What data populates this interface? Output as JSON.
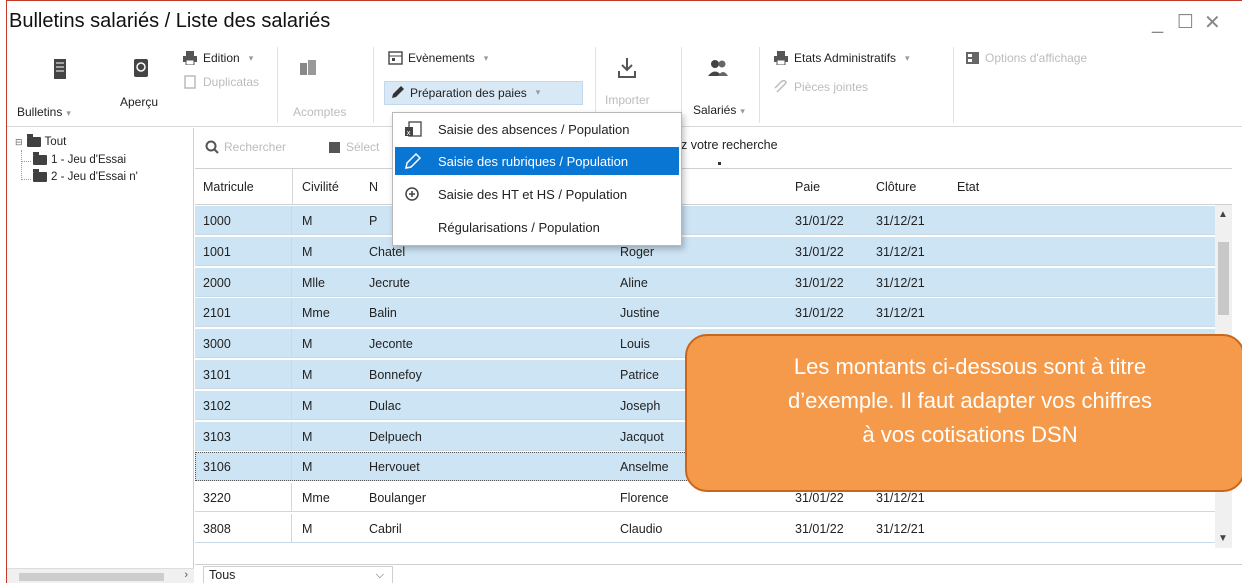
{
  "window": {
    "title": "Bulletins salariés / Liste des salariés",
    "controls": {
      "minimize": "_",
      "maximize": "☐",
      "close": "✕"
    }
  },
  "ribbon": {
    "bulletins": "Bulletins",
    "apercu": "Aperçu",
    "edition": "Edition",
    "duplicatas": "Duplicatas",
    "acomptes": "Acomptes",
    "evenements": "Evènements",
    "preparation": "Préparation des paies",
    "importer": "Importer",
    "salaries": "Salariés",
    "etats": "Etats Administratifs",
    "pieces": "Pièces jointes",
    "options": "Options d'affichage"
  },
  "dropdown": {
    "items": [
      {
        "label": "Saisie des absences / Population",
        "icon": "spreadsheet-icon"
      },
      {
        "label": "Saisie des rubriques / Population",
        "icon": "pencil-icon",
        "active": true
      },
      {
        "label": "Saisie des HT et HS / Population",
        "icon": "plus-circle-icon"
      },
      {
        "label": "Régularisations / Population",
        "icon": ""
      }
    ]
  },
  "tree": {
    "root": "Tout",
    "children": [
      "1 - Jeu d'Essai",
      "2 - Jeu d'Essai n'"
    ]
  },
  "search": {
    "rechercher": "Rechercher",
    "selection": "Sélect",
    "hint": "z votre recherche"
  },
  "grid": {
    "columns": {
      "matricule": "Matricule",
      "civilite": "Civilité",
      "nom": "N",
      "paie": "Paie",
      "cloture": "Clôture",
      "etat": "Etat"
    },
    "rows": [
      {
        "matricule": "1000",
        "civilite": "M",
        "nom": "P",
        "prenom": "",
        "paie": "31/01/22",
        "cloture": "31/12/21"
      },
      {
        "matricule": "1001",
        "civilite": "M",
        "nom": "Chatel",
        "prenom": "Roger",
        "paie": "31/01/22",
        "cloture": "31/12/21"
      },
      {
        "matricule": "2000",
        "civilite": "Mlle",
        "nom": "Jecrute",
        "prenom": "Aline",
        "paie": "31/01/22",
        "cloture": "31/12/21"
      },
      {
        "matricule": "2101",
        "civilite": "Mme",
        "nom": "Balin",
        "prenom": "Justine",
        "paie": "31/01/22",
        "cloture": "31/12/21"
      },
      {
        "matricule": "3000",
        "civilite": "M",
        "nom": "Jeconte",
        "prenom": "Louis",
        "paie": "",
        "cloture": ""
      },
      {
        "matricule": "3101",
        "civilite": "M",
        "nom": "Bonnefoy",
        "prenom": "Patrice",
        "paie": "",
        "cloture": ""
      },
      {
        "matricule": "3102",
        "civilite": "M",
        "nom": "Dulac",
        "prenom": "Joseph",
        "paie": "",
        "cloture": ""
      },
      {
        "matricule": "3103",
        "civilite": "M",
        "nom": "Delpuech",
        "prenom": "Jacquot",
        "paie": "",
        "cloture": ""
      },
      {
        "matricule": "3106",
        "civilite": "M",
        "nom": "Hervouet",
        "prenom": "Anselme",
        "paie": "",
        "cloture": ""
      },
      {
        "matricule": "3220",
        "civilite": "Mme",
        "nom": "Boulanger",
        "prenom": "Florence",
        "paie": "31/01/22",
        "cloture": "31/12/21"
      },
      {
        "matricule": "3808",
        "civilite": "M",
        "nom": "Cabril",
        "prenom": "Claudio",
        "paie": "31/01/22",
        "cloture": "31/12/21"
      }
    ]
  },
  "footer": {
    "filter": "Tous"
  },
  "callout": {
    "line1": "Les montants ci-dessous sont à titre",
    "line2": "d’exemple. Il faut adapter vos chiffres",
    "line3": "à vos cotisations DSN"
  },
  "colors": {
    "selection": "#cde4f4",
    "menu_active": "#0a76d4",
    "callout": "#f59a4a",
    "callout_border": "#c9661a"
  }
}
